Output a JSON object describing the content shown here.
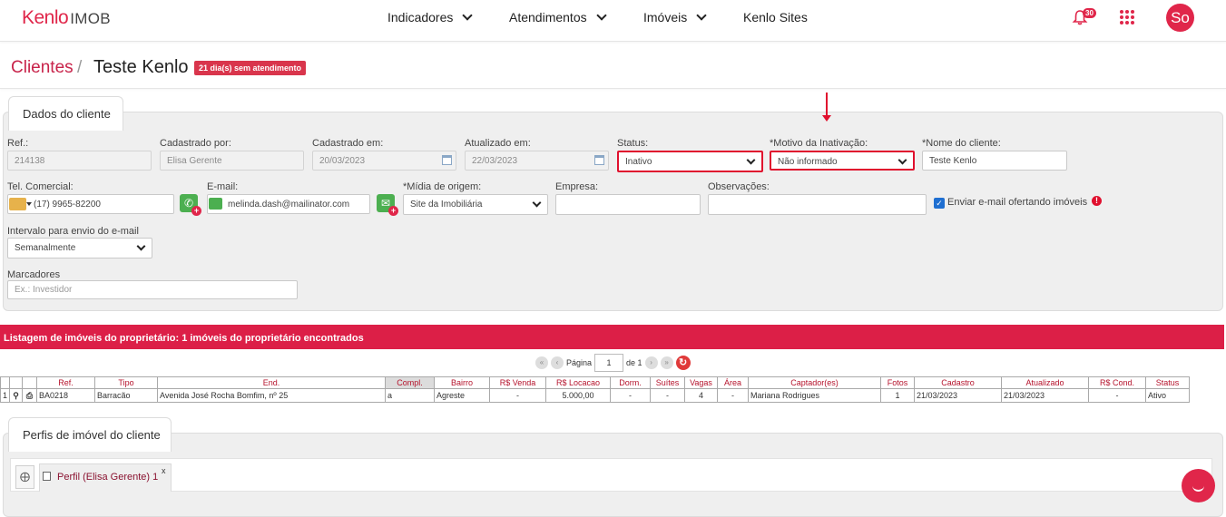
{
  "brand": {
    "logo": "Kenlo",
    "product": "IMOB"
  },
  "nav": {
    "items": [
      "Indicadores",
      "Atendimentos",
      "Imóveis",
      "Kenlo Sites"
    ],
    "notifications": "30",
    "avatar": "So"
  },
  "breadcrumb": {
    "parent": "Clientes",
    "separator": "/",
    "title": "Teste Kenlo",
    "badge": "21 dia(s) sem atendimento"
  },
  "client_panel": {
    "tab": "Dados do cliente",
    "ref": {
      "label": "Ref.:",
      "value": "214138"
    },
    "registered_by": {
      "label": "Cadastrado por:",
      "value": "Elisa Gerente"
    },
    "registered_on": {
      "label": "Cadastrado em:",
      "value": "20/03/2023"
    },
    "updated_on": {
      "label": "Atualizado em:",
      "value": "22/03/2023"
    },
    "status": {
      "label": "Status:",
      "value": "Inativo"
    },
    "inactivation_reason": {
      "label": "*Motivo da Inativação:",
      "value": "Não informado"
    },
    "client_name": {
      "label": "*Nome do cliente:",
      "value": "Teste Kenlo"
    },
    "phone": {
      "label": "Tel. Comercial:",
      "value": "(17) 9965-82200"
    },
    "email": {
      "label": "E-mail:",
      "value": "melinda.dash@mailinator.com"
    },
    "origin": {
      "label": "*Mídia de origem:",
      "value": "Site da Imobiliária"
    },
    "company": {
      "label": "Empresa:",
      "value": ""
    },
    "notes": {
      "label": "Observações:",
      "value": ""
    },
    "send_offers": {
      "label": "Enviar e-mail ofertando imóveis",
      "checked": true
    },
    "email_interval": {
      "label": "Intervalo para envio do e-mail",
      "value": "Semanalmente"
    },
    "tags": {
      "label": "Marcadores",
      "placeholder": "Ex.: Investidor"
    }
  },
  "listing": {
    "title": "Listagem de imóveis do proprietário: 1 imóveis do proprietário encontrados",
    "pager": {
      "page_label": "Página",
      "page": "1",
      "of_label": "de 1"
    },
    "columns": [
      "Ref.",
      "Tipo",
      "End.",
      "Compl.",
      "Bairro",
      "R$ Venda",
      "R$ Locacao",
      "Dorm.",
      "Suítes",
      "Vagas",
      "Área",
      "Captador(es)",
      "Fotos",
      "Cadastro",
      "Atualizado",
      "R$ Cond.",
      "Status"
    ],
    "rows": [
      {
        "index": "1",
        "ref": "BA0218",
        "tipo": "Barracão",
        "end": "Avenida José Rocha Bomfim, nº 25",
        "compl": "a",
        "bairro": "Agreste",
        "venda": "-",
        "locacao": "5.000,00",
        "dorm": "-",
        "suites": "-",
        "vagas": "4",
        "area": "-",
        "captador": "Mariana Rodrigues",
        "fotos": "1",
        "cadastro": "21/03/2023",
        "atualizado": "21/03/2023",
        "cond": "-",
        "status": "Ativo"
      }
    ]
  },
  "profiles": {
    "tab": "Perfis de imóvel do cliente",
    "items": [
      {
        "label": "Perfil (Elisa Gerente) 1",
        "close": "x"
      }
    ]
  },
  "colors": {
    "brand": "#e0264a",
    "listing_bar": "#dc1f47",
    "highlight": "#e0102e"
  }
}
